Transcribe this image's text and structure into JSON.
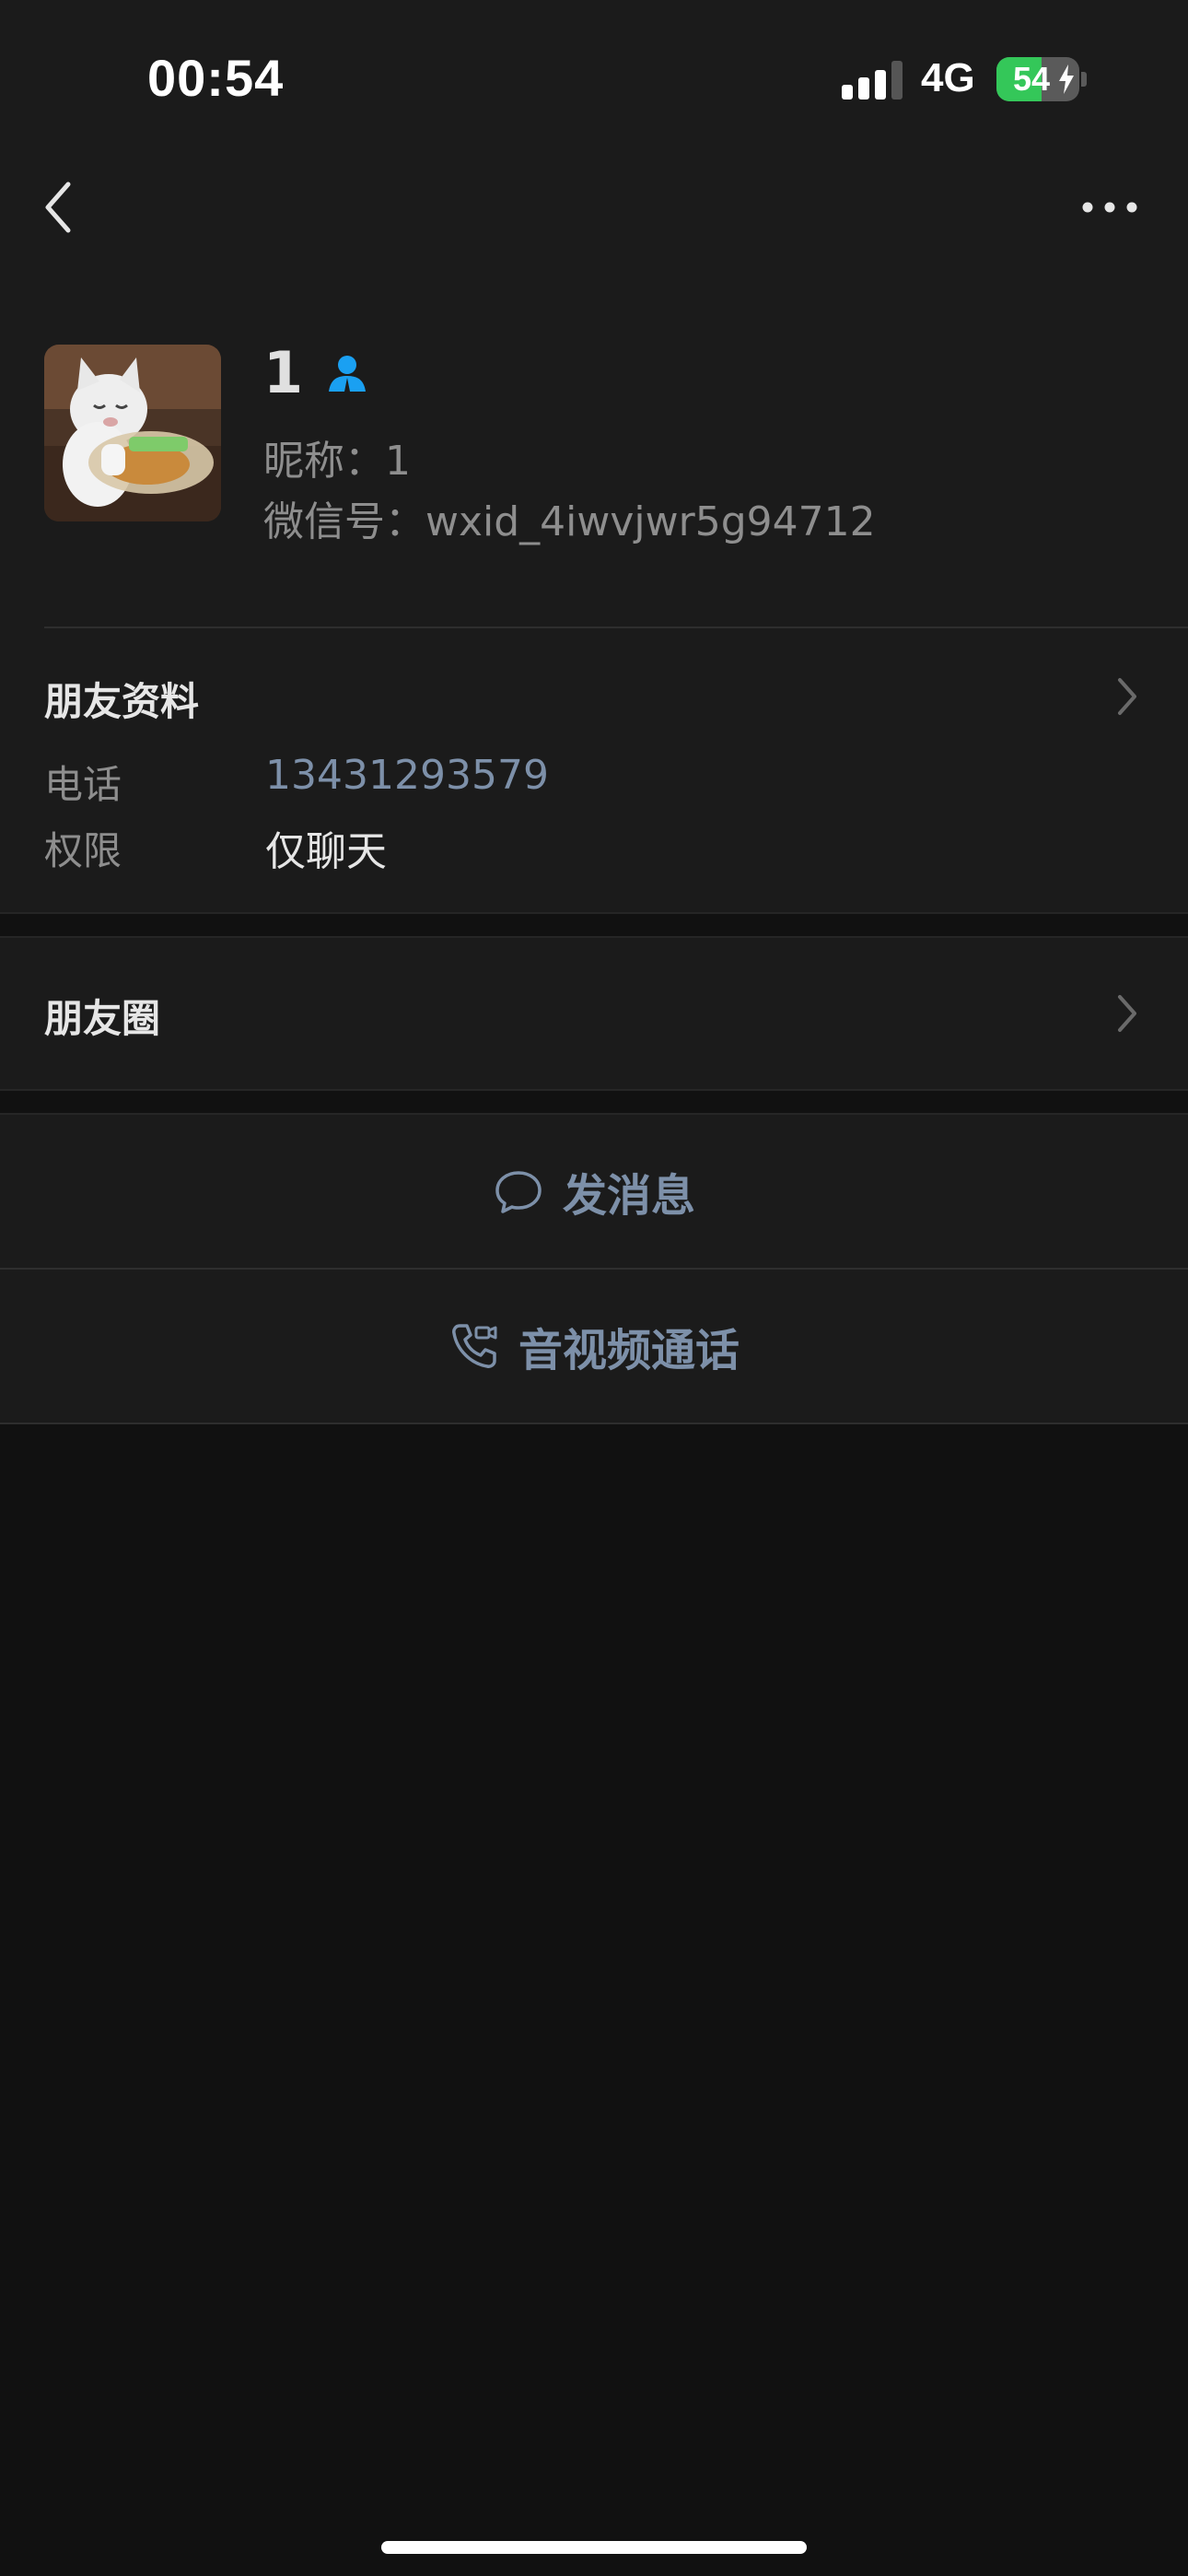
{
  "status_bar": {
    "time": "00:54",
    "network": "4G",
    "battery_percent": "54",
    "battery_level": 0.54,
    "battery_color": "#34c759"
  },
  "nav": {
    "back_icon": "chevron-left-icon",
    "more_icon": "ellipsis-icon"
  },
  "profile": {
    "name": "1",
    "nickname": "昵称：1",
    "wechat_id": "微信号：wxid_4iwvjwr5g94712",
    "contact_icon": "person-icon",
    "contact_icon_color": "#1aa0f2"
  },
  "friend_info": {
    "title": "朋友资料",
    "phone_label": "电话",
    "phone_value": "13431293579",
    "permission_label": "权限",
    "permission_value": "仅聊天"
  },
  "moments": {
    "title": "朋友圈"
  },
  "actions": {
    "message_label": "发消息",
    "message_icon": "chat-bubble-icon",
    "call_label": "音视频通话",
    "call_icon": "phone-video-icon",
    "accent_color": "#7d90a9"
  },
  "colors": {
    "page_background": "#111111",
    "panel_background": "#1b1b1b",
    "secondary_text": "#8e8e8e"
  }
}
